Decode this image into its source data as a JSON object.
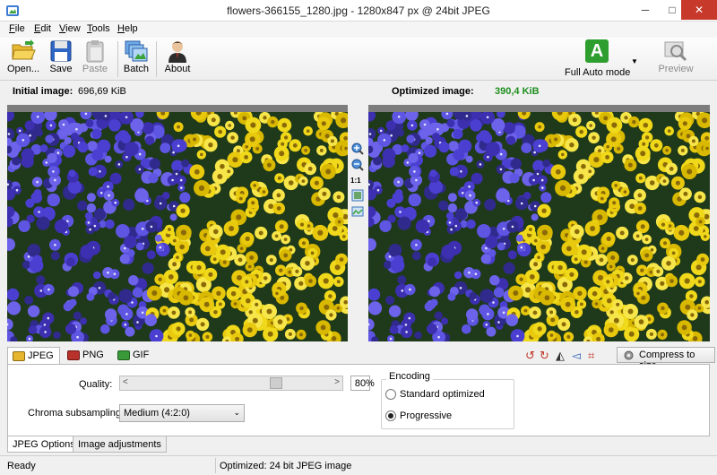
{
  "window": {
    "title": "flowers-366155_1280.jpg - 1280x847 px @ 24bit JPEG",
    "minimize": "─",
    "maximize": "□",
    "close": "✕"
  },
  "menu": [
    {
      "prefix": "",
      "key": "F",
      "rest": "ile"
    },
    {
      "prefix": "",
      "key": "E",
      "rest": "dit"
    },
    {
      "prefix": "",
      "key": "V",
      "rest": "iew"
    },
    {
      "prefix": "",
      "key": "T",
      "rest": "ools"
    },
    {
      "prefix": "",
      "key": "H",
      "rest": "elp"
    }
  ],
  "toolbar": {
    "open": "Open...",
    "save": "Save",
    "paste": "Paste",
    "batch": "Batch",
    "about": "About",
    "full_auto": "Full Auto mode",
    "full_auto_letter": "A",
    "preview": "Preview"
  },
  "info": {
    "initial_label": "Initial image:",
    "initial_value": "696,69 KiB",
    "optimized_label": "Optimized image:",
    "optimized_value": "390,4 KiB"
  },
  "zoom": {
    "one_to_one": "1:1"
  },
  "format_tabs": [
    "JPEG",
    "PNG",
    "GIF"
  ],
  "compress_button": "Compress to size",
  "options": {
    "quality_label": "Quality:",
    "quality_value": "80",
    "quality_fraction": 0.74,
    "percent": "%",
    "chroma_label": "Chroma subsampling:",
    "chroma_value": "Medium (4:2:0)",
    "encoding_title": "Encoding",
    "encoding_options": [
      "Standard optimized",
      "Progressive"
    ],
    "encoding_selected": 1
  },
  "bottom_tabs": [
    "JPEG Options",
    "Image adjustments"
  ],
  "status": {
    "left": "Ready",
    "right": "Optimized: 24 bit JPEG image"
  },
  "colors": {
    "accent_green": "#1f8f1f",
    "close_red": "#c7392b",
    "full_auto": "#2e9e2e"
  }
}
